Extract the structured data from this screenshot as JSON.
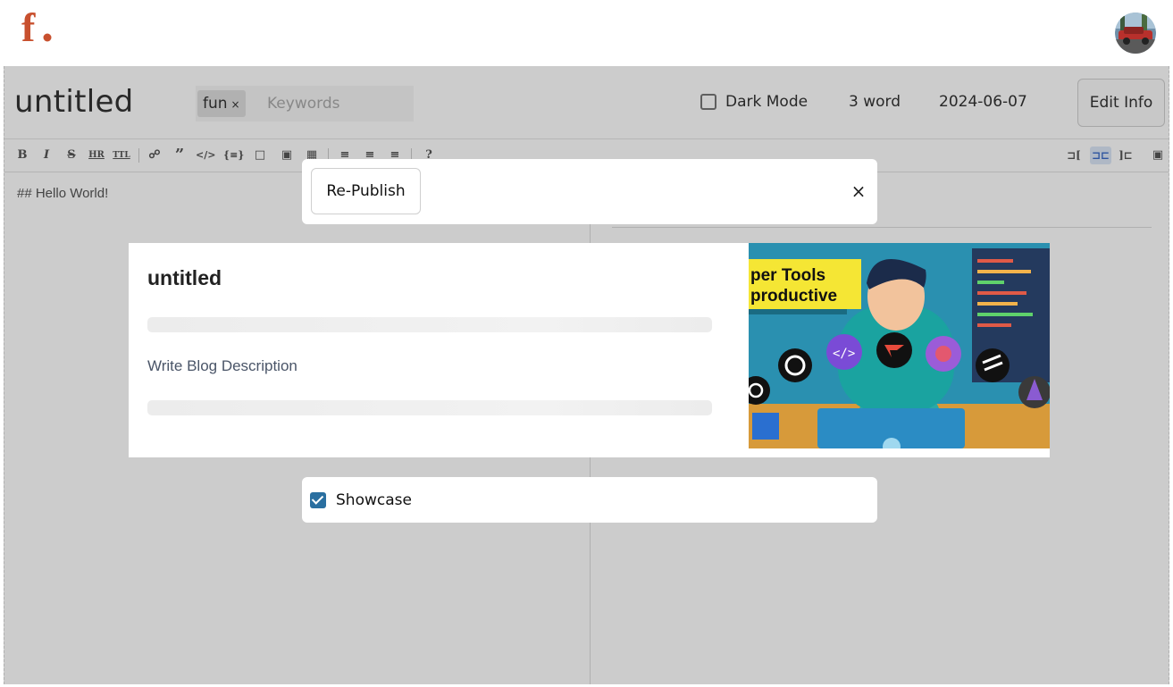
{
  "app": {
    "brand_letter": "f.",
    "brand_color": "#c8502e"
  },
  "editor": {
    "title": "untitled",
    "tags": [
      {
        "label": "fun",
        "remove_symbol": "×"
      }
    ],
    "keywords_placeholder": "Keywords",
    "dark_mode_label": "Dark Mode",
    "dark_mode_checked": false,
    "word_count": "3 word",
    "date": "2024-06-07",
    "edit_info_label": "Edit Info",
    "markdown": "## Hello World!",
    "toolbar": {
      "left_tools": [
        "bold-icon",
        "italic-icon",
        "strikethrough-icon",
        "hr-icon",
        "title-icon",
        "link-icon",
        "quote-icon",
        "code-icon",
        "code-block-icon",
        "comment-icon",
        "image-icon",
        "table-icon",
        "unordered-list-icon",
        "ordered-list-icon",
        "task-list-icon",
        "help-icon"
      ],
      "right_tools": [
        "editor-only-icon",
        "split-view-icon",
        "preview-only-icon",
        "fullscreen-icon"
      ],
      "active_right_tool": "split-view-icon"
    }
  },
  "modal": {
    "republish_label": "Re-Publish",
    "close_symbol": "×",
    "blog_title": "untitled",
    "description_placeholder": "Write Blog Description",
    "cover_banner_lines": [
      "per Tools",
      "productive"
    ],
    "showcase_label": "Showcase",
    "showcase_checked": true,
    "checkbox_color": "#2a6fa0"
  }
}
